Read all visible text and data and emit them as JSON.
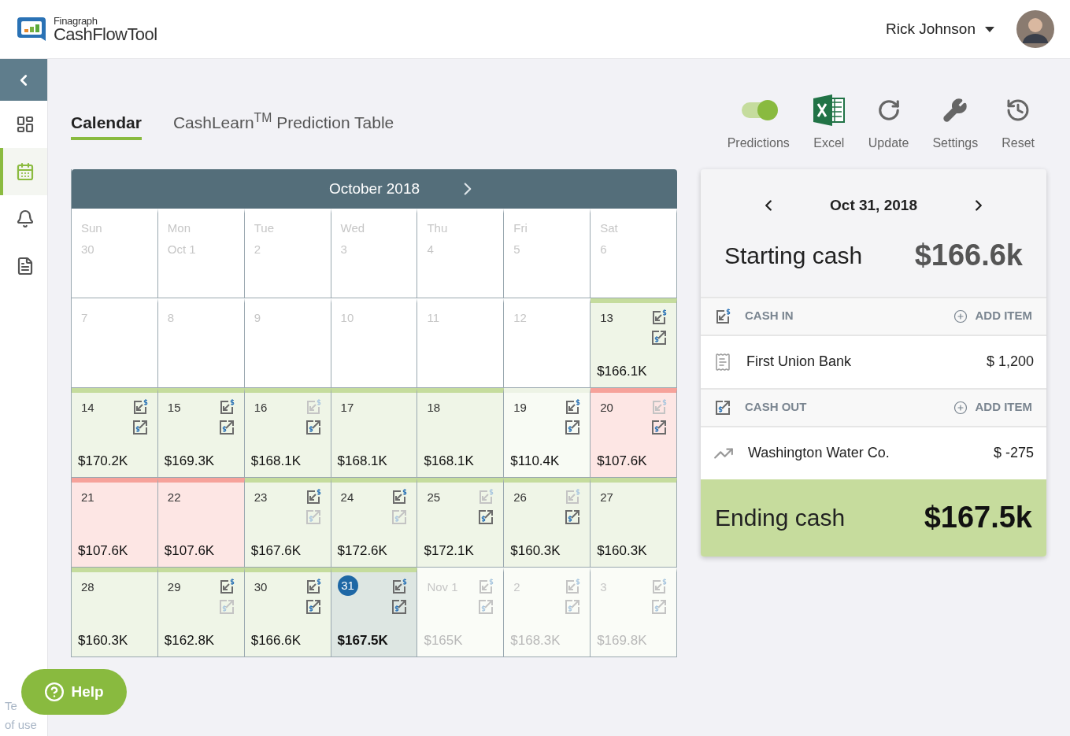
{
  "header": {
    "brand_small": "Finagraph",
    "brand": "CashFlowTool",
    "user": "Rick Johnson"
  },
  "sidebar": {
    "items": [
      {
        "kind": "back",
        "selected": false
      },
      {
        "kind": "dashboard",
        "selected": false
      },
      {
        "kind": "calendar",
        "selected": true
      },
      {
        "kind": "bell",
        "selected": false
      },
      {
        "kind": "document",
        "selected": false
      }
    ],
    "terms": [
      "Te",
      "of use"
    ]
  },
  "tabs": [
    {
      "label": "Calendar",
      "selected": true
    },
    {
      "label": "CashLearn$^{TM}$ Prediction Table",
      "selected": false
    }
  ],
  "toolbar": [
    {
      "kind": "toggle",
      "label": "Predictions",
      "on": true
    },
    {
      "kind": "excel",
      "label": "Excel"
    },
    {
      "kind": "update",
      "label": "Update"
    },
    {
      "kind": "settings",
      "label": "Settings"
    },
    {
      "kind": "reset",
      "label": "Reset"
    }
  ],
  "calendar": {
    "title": "October 2018",
    "cells": [
      {
        "weekday": "Sun",
        "day": "30",
        "kind": "blank",
        "selected": false
      },
      {
        "weekday": "Mon",
        "day": "Oct 1",
        "kind": "blank",
        "selected": false
      },
      {
        "weekday": "Tue",
        "day": "2",
        "kind": "blank",
        "selected": false
      },
      {
        "weekday": "Wed",
        "day": "3",
        "kind": "blank",
        "selected": false
      },
      {
        "weekday": "Thu",
        "day": "4",
        "kind": "blank",
        "selected": false
      },
      {
        "weekday": "Fri",
        "day": "5",
        "kind": "blank",
        "selected": false
      },
      {
        "weekday": "Sat",
        "day": "6",
        "kind": "blank",
        "selected": false
      },
      {
        "day": "7",
        "kind": "blank",
        "selected": false
      },
      {
        "day": "8",
        "kind": "blank",
        "selected": false
      },
      {
        "day": "9",
        "kind": "blank",
        "selected": false
      },
      {
        "day": "10",
        "kind": "blank",
        "selected": false
      },
      {
        "day": "11",
        "kind": "blank",
        "selected": false
      },
      {
        "day": "12",
        "kind": "blank",
        "selected": false
      },
      {
        "day": "13",
        "kind": "green",
        "selected": false,
        "cash_in": true,
        "cash_in_faded": false,
        "cash_out": true,
        "cash_out_faded": false,
        "amount": "$166.1K"
      },
      {
        "day": "14",
        "kind": "green",
        "selected": false,
        "cash_in": true,
        "cash_in_faded": false,
        "cash_out": true,
        "cash_out_faded": false,
        "amount": "$170.2K"
      },
      {
        "day": "15",
        "kind": "green",
        "selected": false,
        "cash_in": true,
        "cash_in_faded": false,
        "cash_out": true,
        "cash_out_faded": false,
        "amount": "$169.3K"
      },
      {
        "day": "16",
        "kind": "green",
        "selected": false,
        "cash_in": true,
        "cash_in_faded": true,
        "cash_out": true,
        "cash_out_faded": false,
        "amount": "$168.1K"
      },
      {
        "day": "17",
        "kind": "green",
        "selected": false,
        "cash_in": false,
        "cash_out": false,
        "amount": "$168.1K"
      },
      {
        "day": "18",
        "kind": "green",
        "selected": false,
        "cash_in": false,
        "cash_out": false,
        "amount": "$168.1K"
      },
      {
        "day": "19",
        "kind": "pale",
        "selected": false,
        "cash_in": true,
        "cash_in_faded": false,
        "cash_out": true,
        "cash_out_faded": false,
        "amount": "$110.4K"
      },
      {
        "day": "20",
        "kind": "red",
        "selected": false,
        "cash_in": true,
        "cash_in_faded": true,
        "cash_out": true,
        "cash_out_faded": false,
        "amount": "$107.6K"
      },
      {
        "day": "21",
        "kind": "red",
        "selected": false,
        "cash_in": false,
        "cash_out": false,
        "amount": "$107.6K"
      },
      {
        "day": "22",
        "kind": "red",
        "selected": false,
        "cash_in": false,
        "cash_out": false,
        "amount": "$107.6K"
      },
      {
        "day": "23",
        "kind": "green",
        "selected": false,
        "cash_in": true,
        "cash_in_faded": false,
        "cash_out": true,
        "cash_out_faded": true,
        "amount": "$167.6K"
      },
      {
        "day": "24",
        "kind": "green",
        "selected": false,
        "cash_in": true,
        "cash_in_faded": false,
        "cash_out": true,
        "cash_out_faded": true,
        "amount": "$172.6K"
      },
      {
        "day": "25",
        "kind": "green",
        "selected": false,
        "cash_in": true,
        "cash_in_faded": true,
        "cash_out": true,
        "cash_out_faded": false,
        "amount": "$172.1K"
      },
      {
        "day": "26",
        "kind": "green",
        "selected": false,
        "cash_in": true,
        "cash_in_faded": true,
        "cash_out": true,
        "cash_out_faded": false,
        "amount": "$160.3K"
      },
      {
        "day": "27",
        "kind": "green",
        "selected": false,
        "cash_in": false,
        "cash_out": false,
        "amount": "$160.3K"
      },
      {
        "day": "28",
        "kind": "green",
        "selected": false,
        "cash_in": false,
        "cash_out": false,
        "amount": "$160.3K"
      },
      {
        "day": "29",
        "kind": "green",
        "selected": false,
        "cash_in": true,
        "cash_in_faded": false,
        "cash_out": true,
        "cash_out_faded": true,
        "amount": "$162.8K"
      },
      {
        "day": "30",
        "kind": "green",
        "selected": false,
        "cash_in": true,
        "cash_in_faded": false,
        "cash_out": true,
        "cash_out_faded": false,
        "amount": "$166.6K"
      },
      {
        "day": "31",
        "kind": "green",
        "selected": true,
        "cash_in": true,
        "cash_in_faded": false,
        "cash_out": true,
        "cash_out_faded": false,
        "amount": "$167.5K"
      },
      {
        "day": "Nov 1",
        "kind": "future",
        "selected": false,
        "cash_in": true,
        "cash_in_faded": true,
        "cash_out": true,
        "cash_out_faded": true,
        "amount": "$165K"
      },
      {
        "day": "2",
        "kind": "future",
        "selected": false,
        "cash_in": true,
        "cash_in_faded": true,
        "cash_out": true,
        "cash_out_faded": true,
        "amount": "$168.3K"
      },
      {
        "day": "3",
        "kind": "future",
        "selected": false,
        "cash_in": true,
        "cash_in_faded": true,
        "cash_out": true,
        "cash_out_faded": true,
        "amount": "$169.8K"
      }
    ]
  },
  "day_panel": {
    "date": "Oct 31, 2018",
    "starting_label": "Starting cash",
    "starting_value": "$166.6k",
    "sections": [
      {
        "kind": "in",
        "title": "CASH IN",
        "action": "ADD ITEM",
        "items": [
          {
            "kind": "bill",
            "name": "First Union Bank",
            "amount": "$ 1,200"
          }
        ]
      },
      {
        "kind": "out",
        "title": "CASH OUT",
        "action": "ADD ITEM",
        "items": [
          {
            "kind": "trend",
            "name": "Washington Water Co.",
            "amount": "$ -275"
          }
        ]
      }
    ],
    "ending_label": "Ending cash",
    "ending_value": "$167.5k"
  },
  "help": "Help"
}
